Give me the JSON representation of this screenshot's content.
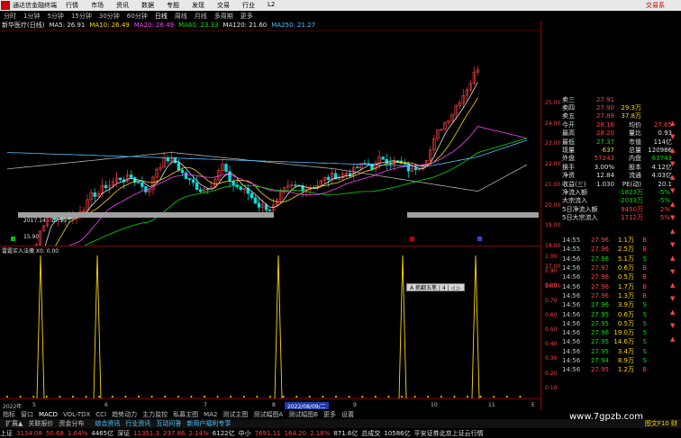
{
  "app": {
    "title": "通达信金融终端",
    "menu": [
      "行情",
      "市场",
      "资讯",
      "数据",
      "专题",
      "发现",
      "交易",
      "行业",
      "L2"
    ],
    "trade_label": "交易系"
  },
  "periods": [
    "分时",
    "1分钟",
    "5分钟",
    "15分钟",
    "30分钟",
    "60分钟",
    "日线",
    "周线",
    "月线",
    "多周期",
    "更多"
  ],
  "selected_period": "日线",
  "stock": {
    "name": "新华医疗(日线)",
    "ma_labels": [
      "MA5: 26.91",
      "MA10: 26.49",
      "MA20: 26.49",
      "MA60: 23.33",
      "MA120: 21.60",
      "MA250: 21.27"
    ],
    "ma_colors": [
      "#e0e0e0",
      "#ffd700",
      "#ff40ff",
      "#00e000",
      "#e0e0e0",
      "#4fc3ff"
    ]
  },
  "price_axis": [
    "25.00",
    "24.00",
    "23.00",
    "22.00",
    "21.00",
    "20.00",
    "19.00",
    "18.00",
    "17.00",
    "16.00"
  ],
  "annotations": {
    "low_range": "2017.14 - 17.50",
    "low_price": "15.90"
  },
  "indicator": {
    "label": "雷霆买入法擒 X0: 0.00",
    "axis": [
      "1.00",
      "0.90",
      "0.80",
      "0.70",
      "0.60",
      "0.50",
      "0.40",
      "0.30",
      "0.20",
      "0.10"
    ],
    "spikes": [
      0.075,
      0.18,
      0.515,
      0.745,
      0.88
    ]
  },
  "popup": "A 抓翻五笔 | 4 | ◁ ▷",
  "time_axis": {
    "start": "2022年",
    "marks": [
      "5",
      "6",
      "7",
      "8",
      "9",
      "10",
      "11"
    ],
    "date_tag": "2022/08/09/二",
    "end": "E"
  },
  "quotes": {
    "rows": [
      {
        "a": "卖三",
        "b": "27.91",
        "c": "",
        "d": "",
        "cb": "red",
        "cd": "yel"
      },
      {
        "a": "卖四",
        "b": "27.90",
        "c": "29.3万",
        "d": "",
        "cb": "red",
        "cd": "yel"
      },
      {
        "a": "卖五",
        "b": "27.89",
        "c": "37.8万",
        "d": "",
        "cb": "red",
        "cd": "yel"
      },
      {
        "a": "今开",
        "b": "28.16",
        "c": "均价",
        "d": "27.65",
        "cb": "red",
        "cd": "red"
      },
      {
        "a": "最高",
        "b": "28.20",
        "c": "量比",
        "d": "0.93",
        "cb": "red",
        "cd": "wht"
      },
      {
        "a": "最低",
        "b": "27.37",
        "c": "市值",
        "d": "114亿",
        "cb": "grn",
        "cd": "wht"
      },
      {
        "a": "现量",
        "b": "637",
        "c": "总量",
        "d": "120986",
        "cb": "yel",
        "cd": "wht"
      },
      {
        "a": "外盘",
        "b": "57243",
        "c": "内盘",
        "d": "63743",
        "cb": "red",
        "cd": "grn"
      },
      {
        "a": "换手",
        "b": "3.00%",
        "c": "股本",
        "d": "4.12亿",
        "cb": "wht",
        "cd": "wht"
      },
      {
        "a": "净资",
        "b": "12.84",
        "c": "流通",
        "d": "4.03亿",
        "cb": "wht",
        "cd": "wht"
      },
      {
        "a": "收益(三)",
        "b": "1.030",
        "c": "PE(动)",
        "d": "20.1",
        "cb": "wht",
        "cd": "wht"
      }
    ],
    "flows": [
      {
        "a": "净流入额",
        "b": "-1823万",
        "c": "-5%",
        "cb": "grn",
        "cc": "grn"
      },
      {
        "a": "大宗流入",
        "b": "-2033万",
        "c": "-5%",
        "cb": "grn",
        "cc": "grn"
      },
      {
        "a": "5日净流入额",
        "b": "9450万",
        "c": "2%",
        "cb": "red",
        "cc": "red"
      },
      {
        "a": "5日大宗流入",
        "b": "1712万",
        "c": "5%",
        "cb": "red",
        "cc": "red"
      }
    ]
  },
  "ticks": [
    {
      "t": "14:55",
      "p": "27.96",
      "v": "1.1万",
      "d": "B"
    },
    {
      "t": "14:55",
      "p": "27.96",
      "v": "2.5万",
      "d": "B"
    },
    {
      "t": "14:56",
      "p": "27.96",
      "v": "5.1万",
      "d": "S"
    },
    {
      "t": "14:56",
      "p": "27.97",
      "v": "0.6万",
      "d": "B"
    },
    {
      "t": "14:56",
      "p": "27.96",
      "v": "0.5万",
      "d": "B"
    },
    {
      "t": "14:56",
      "p": "27.96",
      "v": "1.7万",
      "d": "B"
    },
    {
      "t": "14:56",
      "p": "27.96",
      "v": "1.3万",
      "d": "B"
    },
    {
      "t": "14:56",
      "p": "27.96",
      "v": "3.9万",
      "d": "S"
    },
    {
      "t": "14:56",
      "p": "27.95",
      "v": "0.6万",
      "d": "S"
    },
    {
      "t": "14:56",
      "p": "27.95",
      "v": "0.5万",
      "d": "S"
    },
    {
      "t": "14:56",
      "p": "27.96",
      "v": "19.0万",
      "d": "S"
    },
    {
      "t": "14:56",
      "p": "27.95",
      "v": "14.6万",
      "d": "S"
    },
    {
      "t": "14:56",
      "p": "27.95",
      "v": "3.4万",
      "d": "S"
    },
    {
      "t": "14:56",
      "p": "27.94",
      "v": "8.9万",
      "d": "S"
    },
    {
      "t": "14:56",
      "p": "27.95",
      "v": "1.2万",
      "d": "B"
    }
  ],
  "tabs": [
    "指标",
    "窗口",
    "MACD",
    "VOL-TDX",
    "CCI",
    "趋势动力",
    "主力监控",
    "私募主图",
    "MA2",
    "测试主图",
    "测试幅图A",
    "测试幅图B",
    "更多",
    "设置"
  ],
  "selected_tab": "MACD",
  "tabs2": [
    "扩展▲",
    "关联报价",
    "资金分布"
  ],
  "tabs2_mid": [
    "综合资讯",
    "行业资讯",
    "互动问答",
    "新用户福利专享"
  ],
  "tabs2_tail": "图文F10 财",
  "status": [
    {
      "text": "上证",
      "c": "wht"
    },
    {
      "text": "3134.08",
      "c": "red"
    },
    {
      "text": "50.68",
      "c": "red"
    },
    {
      "text": "1.64%",
      "c": "red"
    },
    {
      "text": "4465亿",
      "c": "wht"
    },
    {
      "text": "深证",
      "c": "wht"
    },
    {
      "text": "11351.3",
      "c": "red"
    },
    {
      "text": "237.86",
      "c": "red"
    },
    {
      "text": "2.14%",
      "c": "red"
    },
    {
      "text": "6122亿",
      "c": "wht"
    },
    {
      "text": "中小",
      "c": "wht"
    },
    {
      "text": "7691.11",
      "c": "red"
    },
    {
      "text": "164.20",
      "c": "red"
    },
    {
      "text": "2.18%",
      "c": "red"
    },
    {
      "text": "871.6亿",
      "c": "wht"
    },
    {
      "text": "总成交",
      "c": "wht"
    },
    {
      "text": "10586亿",
      "c": "wht"
    },
    {
      "text": "平安证券北京上证云行情",
      "c": "wht"
    }
  ],
  "watermark": "www.7gpzb.com"
}
